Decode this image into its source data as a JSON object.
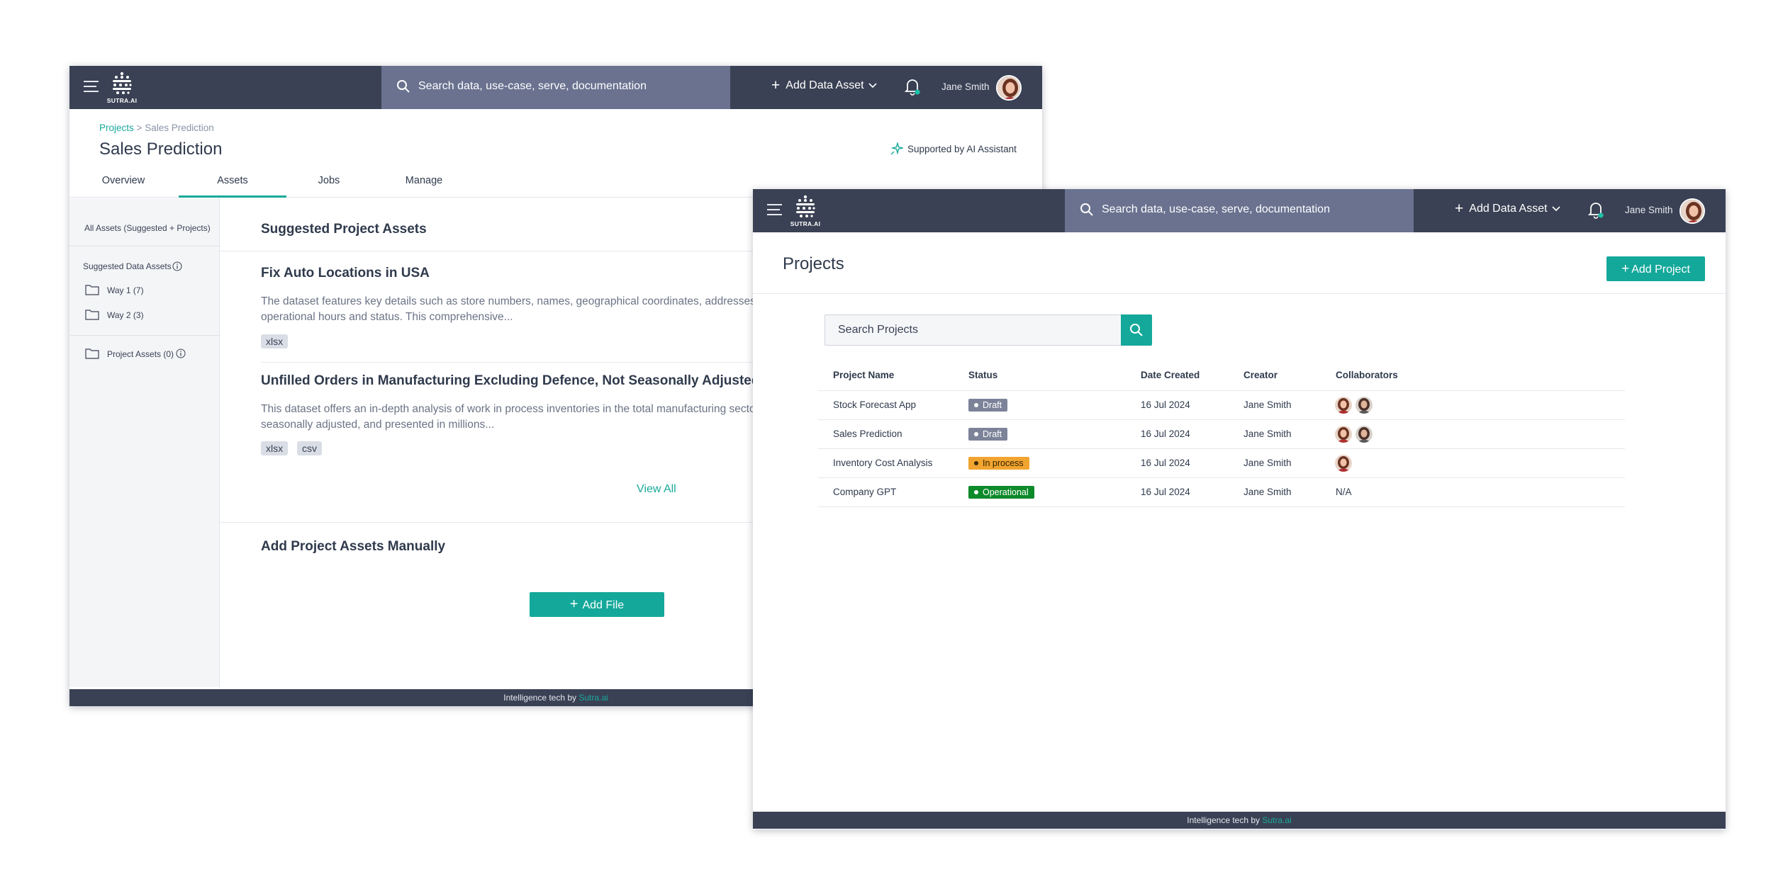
{
  "brand": {
    "logo_text": "SUTRA.AI"
  },
  "topbar": {
    "search_placeholder": "Search data, use-case, serve, documentation",
    "add_data_asset": "Add Data Asset",
    "user_name": "Jane Smith"
  },
  "assets_window": {
    "breadcrumb": {
      "projects": "Projects",
      "separator": ">",
      "current": "Sales Prediction"
    },
    "title": "Sales Prediction",
    "ai_assistant": "Supported by AI Assistant",
    "tabs": [
      {
        "label": "Overview"
      },
      {
        "label": "Assets"
      },
      {
        "label": "Jobs"
      },
      {
        "label": "Manage"
      }
    ],
    "sidebar": {
      "all_assets": "All Assets (Suggested + Projects)",
      "suggested_heading": "Suggested Data Assets",
      "folders": [
        {
          "label": "Way 1 (7)"
        },
        {
          "label": "Way 2 (3)"
        }
      ],
      "project_assets": "Project Assets (0)"
    },
    "suggested_title": "Suggested Project Assets",
    "assets": [
      {
        "title": "Fix Auto Locations in USA",
        "description": "The dataset features key details such as store numbers, names, geographical coordinates, addresses, operational hours and status. This comprehensive...",
        "tags": [
          "xlsx"
        ]
      },
      {
        "title": "Unfilled Orders in Manufacturing Excluding Defence, Not Seasonally Adjusted.",
        "description": "This dataset offers an in-depth analysis of work in process inventories in the total manufacturing sector, not seasonally adjusted, and presented in millions...",
        "tags": [
          "xlsx",
          "csv"
        ]
      }
    ],
    "view_all": "View All",
    "manual_title": "Add Project Assets Manually",
    "add_file": "Add File"
  },
  "projects_window": {
    "title": "Projects",
    "add_project": "Add Project",
    "search_placeholder": "Search Projects",
    "columns": [
      "Project Name",
      "Status",
      "Date Created",
      "Creator",
      "Collaborators"
    ],
    "rows": [
      {
        "name": "Stock Forecast App",
        "status": "Draft",
        "date": "16 Jul 2024",
        "creator": "Jane Smith",
        "collaborators": ""
      },
      {
        "name": "Sales Prediction",
        "status": "Draft",
        "date": "16 Jul 2024",
        "creator": "Jane Smith",
        "collaborators": ""
      },
      {
        "name": "Inventory Cost Analysis",
        "status": "In process",
        "date": "16 Jul 2024",
        "creator": "Jane Smith",
        "collaborators": ""
      },
      {
        "name": "Company GPT",
        "status": "Operational",
        "date": "16 Jul 2024",
        "creator": "Jane Smith",
        "collaborators": "N/A"
      }
    ]
  },
  "footer": {
    "prefix": "Intelligence tech by",
    "brand": "Sutra.ai"
  },
  "colors": {
    "accent": "#14a89a",
    "topbar": "#3a4154",
    "search": "#6a7290",
    "draft": "#7c8399",
    "in_process": "#f2a430",
    "operational": "#0d8a2a"
  }
}
